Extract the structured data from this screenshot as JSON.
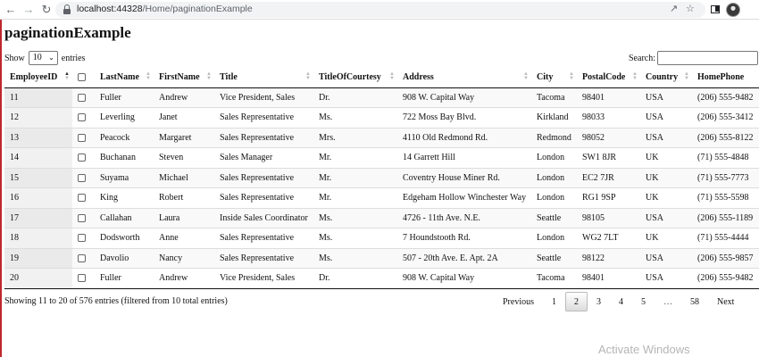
{
  "browser": {
    "url_host": "localhost:44328",
    "url_path": "/Home/paginationExample",
    "icons": [
      "back-arrow-icon",
      "forward-arrow-icon",
      "reload-icon",
      "lock-icon",
      "share-icon",
      "star-icon",
      "side-panel-icon",
      "profile-avatar"
    ]
  },
  "page": {
    "title": "paginationExample"
  },
  "controls": {
    "show_label": "Show",
    "length_value": "10",
    "entries_label": "entries",
    "search_label": "Search:",
    "search_value": ""
  },
  "table": {
    "columns": [
      "EmployeeID",
      "",
      "LastName",
      "FirstName",
      "Title",
      "TitleOfCourtesy",
      "Address",
      "City",
      "PostalCode",
      "Country",
      "HomePhone"
    ],
    "rows": [
      [
        "11",
        "",
        "Fuller",
        "Andrew",
        "Vice President, Sales",
        "Dr.",
        "908 W. Capital Way",
        "Tacoma",
        "98401",
        "USA",
        "(206) 555-9482"
      ],
      [
        "12",
        "",
        "Leverling",
        "Janet",
        "Sales Representative",
        "Ms.",
        "722 Moss Bay Blvd.",
        "Kirkland",
        "98033",
        "USA",
        "(206) 555-3412"
      ],
      [
        "13",
        "",
        "Peacock",
        "Margaret",
        "Sales Representative",
        "Mrs.",
        "4110 Old Redmond Rd.",
        "Redmond",
        "98052",
        "USA",
        "(206) 555-8122"
      ],
      [
        "14",
        "",
        "Buchanan",
        "Steven",
        "Sales Manager",
        "Mr.",
        "14 Garrett Hill",
        "London",
        "SW1 8JR",
        "UK",
        "(71) 555-4848"
      ],
      [
        "15",
        "",
        "Suyama",
        "Michael",
        "Sales Representative",
        "Mr.",
        "Coventry House Miner Rd.",
        "London",
        "EC2 7JR",
        "UK",
        "(71) 555-7773"
      ],
      [
        "16",
        "",
        "King",
        "Robert",
        "Sales Representative",
        "Mr.",
        "Edgeham Hollow Winchester Way",
        "London",
        "RG1 9SP",
        "UK",
        "(71) 555-5598"
      ],
      [
        "17",
        "",
        "Callahan",
        "Laura",
        "Inside Sales Coordinator",
        "Ms.",
        "4726 - 11th Ave. N.E.",
        "Seattle",
        "98105",
        "USA",
        "(206) 555-1189"
      ],
      [
        "18",
        "",
        "Dodsworth",
        "Anne",
        "Sales Representative",
        "Ms.",
        "7 Houndstooth Rd.",
        "London",
        "WG2 7LT",
        "UK",
        "(71) 555-4444"
      ],
      [
        "19",
        "",
        "Davolio",
        "Nancy",
        "Sales Representative",
        "Ms.",
        "507 - 20th Ave. E. Apt. 2A",
        "Seattle",
        "98122",
        "USA",
        "(206) 555-9857"
      ],
      [
        "20",
        "",
        "Fuller",
        "Andrew",
        "Vice President, Sales",
        "Dr.",
        "908 W. Capital Way",
        "Tacoma",
        "98401",
        "USA",
        "(206) 555-9482"
      ]
    ]
  },
  "footer": {
    "info": "Showing 11 to 20 of 576 entries (filtered from 10 total entries)",
    "pagination": [
      {
        "label": "Previous",
        "type": "prev"
      },
      {
        "label": "1",
        "type": "page"
      },
      {
        "label": "2",
        "type": "current"
      },
      {
        "label": "3",
        "type": "page"
      },
      {
        "label": "4",
        "type": "page"
      },
      {
        "label": "5",
        "type": "page"
      },
      {
        "label": "…",
        "type": "ellipsis"
      },
      {
        "label": "58",
        "type": "page"
      },
      {
        "label": "Next",
        "type": "next"
      }
    ]
  },
  "watermark": "Activate Windows"
}
